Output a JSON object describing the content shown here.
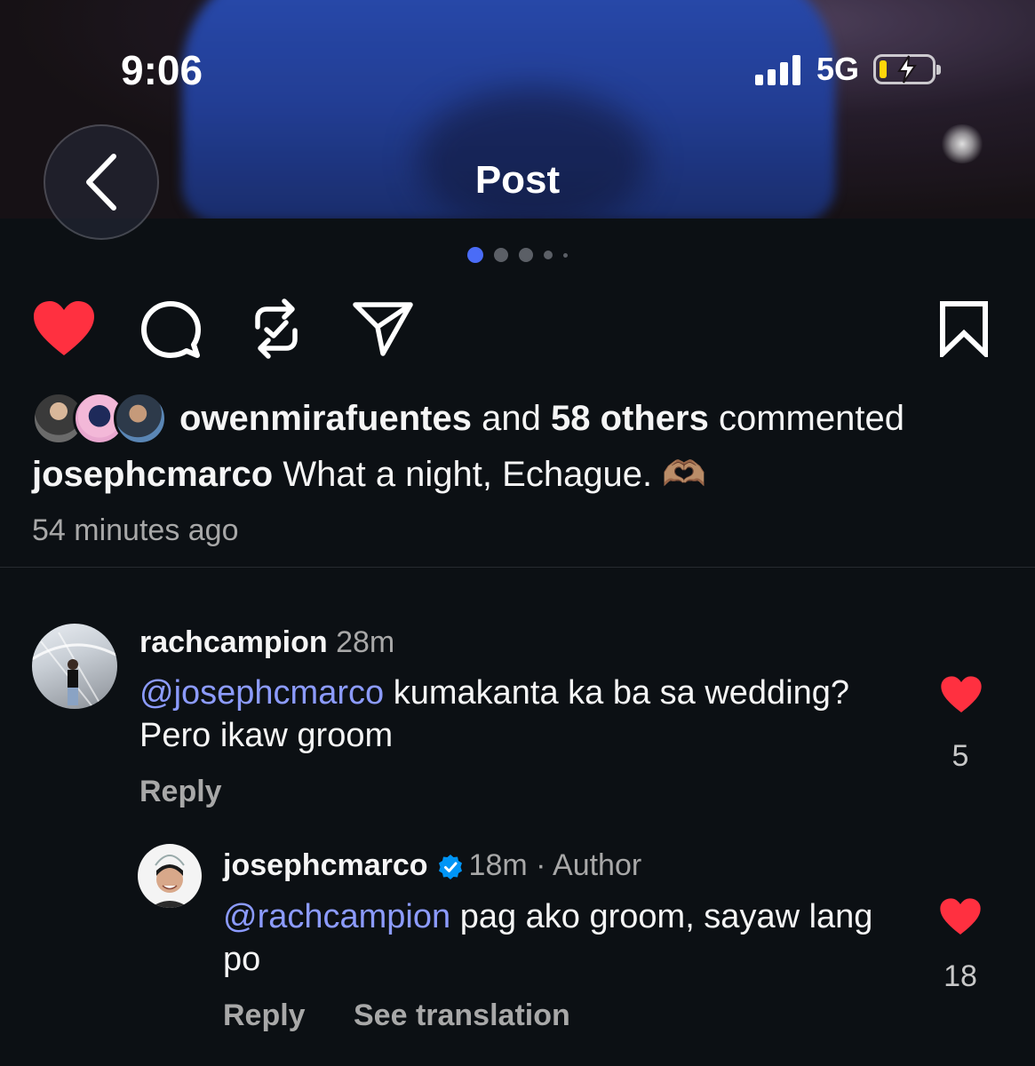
{
  "status_bar": {
    "time": "9:06",
    "network": "5G",
    "battery_color": "#ffd60a"
  },
  "header": {
    "title": "Post",
    "back_icon": "chevron-left-icon"
  },
  "carousel": {
    "active_index": 0,
    "dot_count": 5,
    "active_color": "#4a6cf7"
  },
  "actions": {
    "like_icon": "heart-filled-icon",
    "like_color": "#ff3040",
    "comment_icon": "comment-icon",
    "repost_icon": "repost-icon",
    "share_icon": "send-icon",
    "save_icon": "bookmark-icon"
  },
  "engagement": {
    "first_commenter": "owenmirafuentes",
    "connector": "and",
    "others": "58 others",
    "suffix": "commented"
  },
  "post": {
    "author": "josephcmarco",
    "caption": "What a night, Echague. 🫶🏽",
    "time_ago": "54 minutes ago"
  },
  "comments": [
    {
      "username": "rachcampion",
      "time": "28m",
      "mention": "@josephcmarco",
      "text": " kumakanta ka ba sa wedding? Pero ikaw groom",
      "likes": "5",
      "reply_label": "Reply"
    },
    {
      "username": "josephcmarco",
      "verified": true,
      "time": "18m",
      "author_label": "· Author",
      "mention": "@rachcampion",
      "text": " pag ako groom, sayaw lang po",
      "likes": "18",
      "reply_label": "Reply",
      "translate_label": "See translation"
    }
  ],
  "colors": {
    "background": "#0c1014",
    "mention": "#8c9bff",
    "heart": "#ff3040",
    "verified": "#0095f6"
  }
}
